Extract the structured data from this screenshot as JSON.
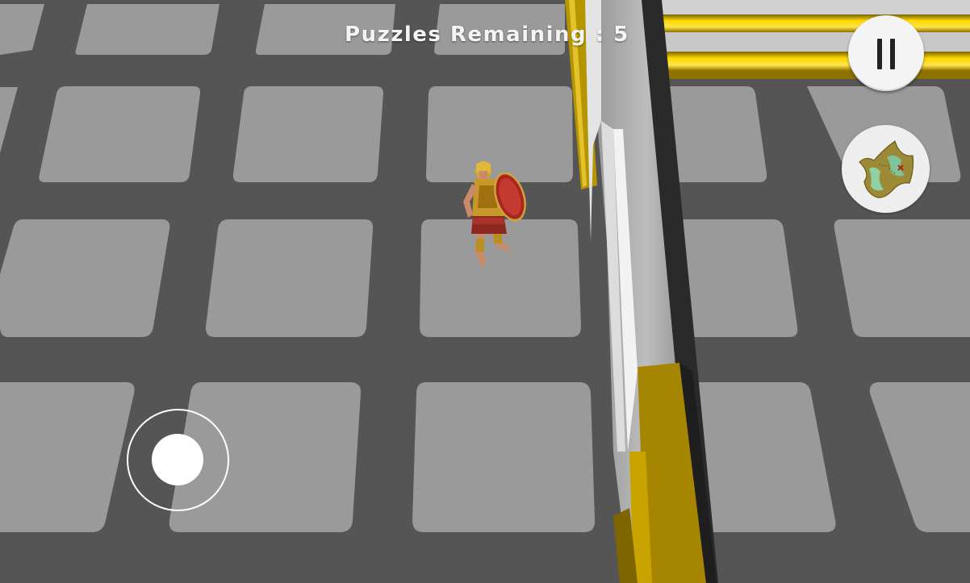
{
  "hud": {
    "puzzles_label": "Puzzles Remaining",
    "separator": " : ",
    "puzzles_remaining": "5"
  },
  "buttons": {
    "pause_icon": "pause-icon",
    "map_icon": "treasure-map-icon"
  },
  "joystick": {
    "icon": "virtual-joystick"
  },
  "colors": {
    "floor_gap": "#555555",
    "floor_tile": "#9a9a9a",
    "wall_gold": "#b08f00",
    "wall_stone": "#8e8e8e",
    "hud_text": "#f4f4f4",
    "button_bg": "#f4f4f4"
  },
  "character": {
    "type": "spartan-warrior",
    "shield_color": "#b8302a",
    "armor_color": "#c9a020"
  }
}
